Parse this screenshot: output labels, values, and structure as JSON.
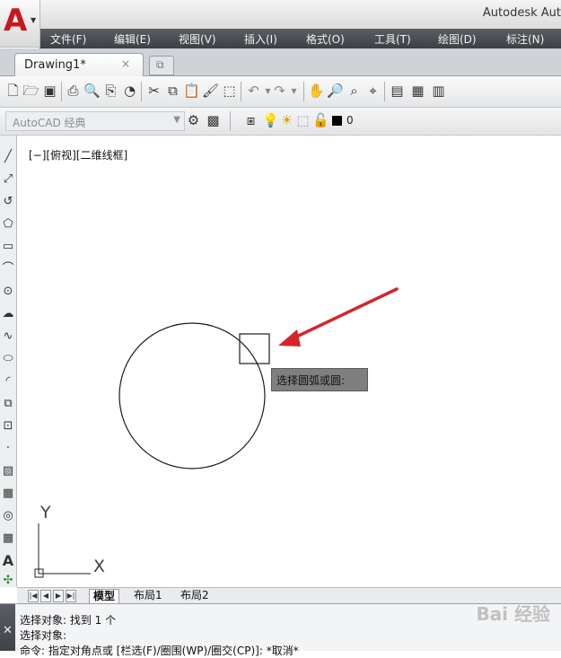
{
  "app": {
    "title": "Autodesk Aut"
  },
  "menu": [
    "文件(F)",
    "编辑(E)",
    "视图(V)",
    "插入(I)",
    "格式(O)",
    "工具(T)",
    "绘图(D)",
    "标注(N)"
  ],
  "tabs": {
    "document": "Drawing1*",
    "close": "×"
  },
  "toolbar2": {
    "workspace": "AutoCAD 经典",
    "layer_value": "0"
  },
  "canvas": {
    "viewport_label": "[−][俯视][二维线框]",
    "tooltip": "选择圆弧或圆:",
    "ucs": {
      "y_label": "Y",
      "x_label": "X"
    }
  },
  "layout_tabs": [
    "模型",
    "布局1",
    "布局2"
  ],
  "command_lines": [
    "选择对象: 找到 1 个",
    "选择对象:",
    "命令: 指定对角点或 [栏选(F)/圈围(WP)/圈交(CP)]: *取消*"
  ],
  "watermark": "Bai 经验",
  "colors": {
    "arrow": "#d8232a",
    "logo": "#c8171a",
    "menubar": "#45484d",
    "tooltip_bg": "#7f7f7f"
  },
  "icons": {
    "toolbar1": [
      "new-icon",
      "open-icon",
      "save-icon",
      "print-icon",
      "print-preview-icon",
      "publish-icon",
      "3d-print-icon",
      "cut-icon",
      "copy-icon",
      "paste-icon",
      "match-properties-icon",
      "block-editor-icon",
      "undo-icon",
      "redo-icon",
      "pan-icon",
      "zoom-realtime-icon",
      "zoom-window-icon",
      "zoom-previous-icon",
      "properties-icon",
      "design-center-icon",
      "tool-palettes-icon"
    ],
    "left_toolbar": [
      "line-icon",
      "construction-line-icon",
      "polyline-icon",
      "polygon-icon",
      "rectangle-icon",
      "arc-icon",
      "circle-icon",
      "revision-cloud-icon",
      "spline-icon",
      "ellipse-icon",
      "ellipse-arc-icon",
      "insert-block-icon",
      "make-block-icon",
      "point-icon",
      "hatch-icon",
      "gradient-icon",
      "region-icon",
      "table-icon",
      "multiline-text-icon",
      "add-selected-icon"
    ]
  }
}
